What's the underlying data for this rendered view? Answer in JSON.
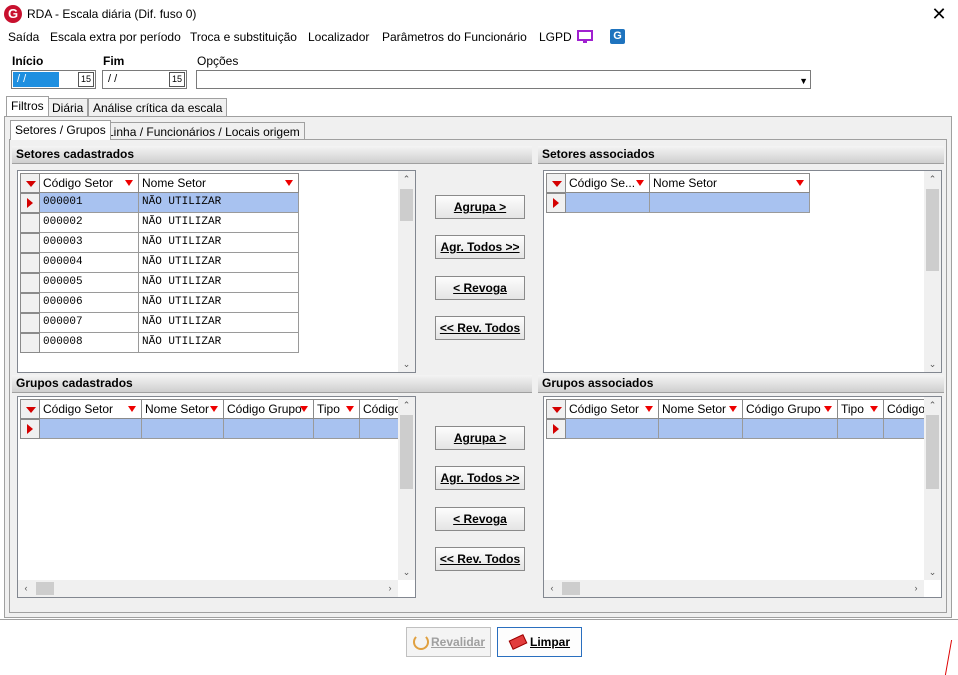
{
  "window": {
    "title": "RDA - Escala diária (Dif. fuso 0)",
    "logo_letter": "G",
    "close_glyph": "✕"
  },
  "menu": [
    "Saída",
    "Escala extra por período",
    "Troca e substituição",
    "Localizador",
    "Parâmetros do Funcionário",
    "LGPD"
  ],
  "menu_icons": {
    "monitor": "monitor-icon",
    "app": "G"
  },
  "filters": {
    "inicio_label": "Início",
    "inicio_value": "/ /",
    "fim_label": "Fim",
    "fim_value": "/ /",
    "opcoes_label": "Opções",
    "opcoes_value": "",
    "calendar_glyph": "15"
  },
  "tabs": [
    "Filtros",
    "Diária",
    "Análise crítica da escala"
  ],
  "subtabs": [
    "Setores / Grupos",
    "Linha / Funcionários / Locais origem"
  ],
  "setores_cadastrados": {
    "title": "Setores cadastrados",
    "columns": [
      "Código Setor",
      "Nome Setor"
    ],
    "rows": [
      [
        "000001",
        "NÃO UTILIZAR"
      ],
      [
        "000002",
        "NÃO UTILIZAR"
      ],
      [
        "000003",
        "NÃO UTILIZAR"
      ],
      [
        "000004",
        "NÃO UTILIZAR"
      ],
      [
        "000005",
        "NÃO UTILIZAR"
      ],
      [
        "000006",
        "NÃO UTILIZAR"
      ],
      [
        "000007",
        "NÃO UTILIZAR"
      ],
      [
        "000008",
        "NÃO UTILIZAR"
      ]
    ]
  },
  "setores_associados": {
    "title": "Setores associados",
    "columns": [
      "Código Se...",
      "Nome Setor"
    ]
  },
  "grupos_cadastrados": {
    "title": "Grupos cadastrados",
    "columns": [
      "Código Setor",
      "Nome Setor",
      "Código Grupo",
      "Tipo",
      "Código"
    ]
  },
  "grupos_associados": {
    "title": "Grupos associados",
    "columns": [
      "Código Setor",
      "Nome Setor",
      "Código Grupo",
      "Tipo",
      "Código"
    ]
  },
  "transfer_buttons": {
    "agrupa": "Agrupa >",
    "agr_todos": "Agr. Todos >>",
    "revoga": "< Revoga",
    "rev_todos": "<< Rev. Todos"
  },
  "footer": {
    "revalidar": "Revalidar",
    "limpar": "Limpar"
  },
  "colors": {
    "accent": "#1e8fe0",
    "selected_row": "#a8c2f0",
    "filter_icon": "#e00000",
    "logo": "#c8102e"
  }
}
